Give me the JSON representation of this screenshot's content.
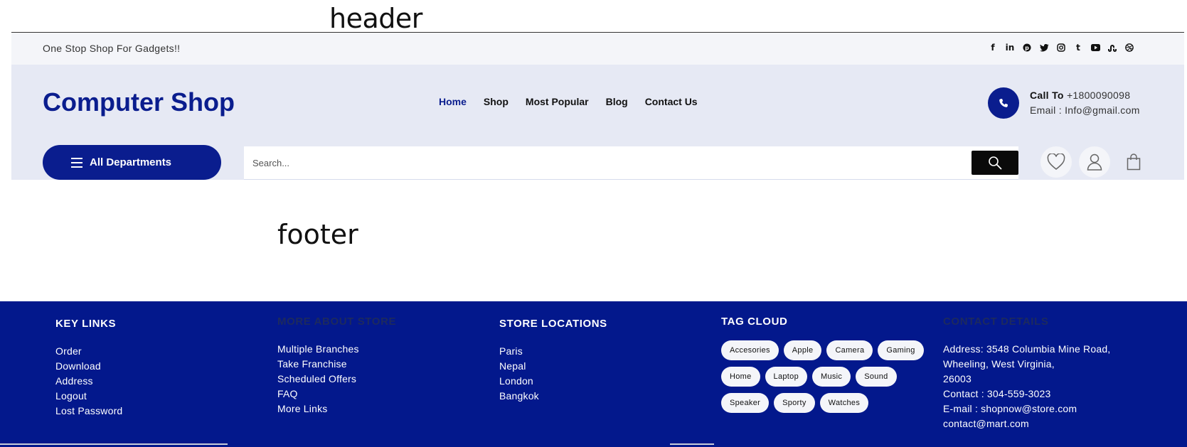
{
  "labels": {
    "header": "header",
    "footer": "footer"
  },
  "topbar": {
    "tagline": "One Stop Shop For Gadgets!!",
    "socials": [
      "facebook-icon",
      "linkedin-icon",
      "pinterest-icon",
      "twitter-icon",
      "instagram-icon",
      "tumblr-icon",
      "youtube-icon",
      "stumbleupon-icon",
      "dribbble-icon"
    ]
  },
  "brand": {
    "name": "Computer Shop"
  },
  "nav": {
    "items": [
      {
        "label": "Home",
        "active": true
      },
      {
        "label": "Shop"
      },
      {
        "label": "Most Popular"
      },
      {
        "label": "Blog"
      },
      {
        "label": "Contact Us"
      }
    ]
  },
  "call": {
    "label": "Call To",
    "phone": "+1800090098",
    "email_label": "Email :",
    "email": "Info@gmail.com"
  },
  "departments": {
    "label": "All Departments"
  },
  "search": {
    "placeholder": "Search..."
  },
  "colors": {
    "primary": "#0a1d8e",
    "topbar_bg": "#f4f5f9",
    "mainbar_bg": "#e6e9f4",
    "footer_bg": "#03188c"
  },
  "footer": {
    "key_links": {
      "title": "KEY LINKS",
      "items": [
        "Order",
        "Download",
        "Address",
        "Logout",
        "Lost Password"
      ]
    },
    "more_about": {
      "title": "MORE ABOUT STORE",
      "items": [
        "Multiple Branches",
        "Take Franchise",
        "Scheduled Offers",
        "FAQ",
        "More Links"
      ]
    },
    "locations": {
      "title": "STORE LOCATIONS",
      "items": [
        "Paris",
        "Nepal",
        "London",
        "Bangkok"
      ]
    },
    "tag_cloud": {
      "title": "TAG CLOUD",
      "tags": [
        "Accesories",
        "Apple",
        "Camera",
        "Gaming",
        "Home",
        "Laptop",
        "Music",
        "Sound",
        "Speaker",
        "Sporty",
        "Watches"
      ]
    },
    "contact": {
      "title": "CONTACT DETAILS",
      "lines": [
        "Address: 3548 Columbia Mine Road,",
        "Wheeling, West Virginia,",
        "26003",
        "Contact : 304-559-3023",
        "E-mail : shopnow@store.com",
        "contact@mart.com"
      ]
    }
  }
}
